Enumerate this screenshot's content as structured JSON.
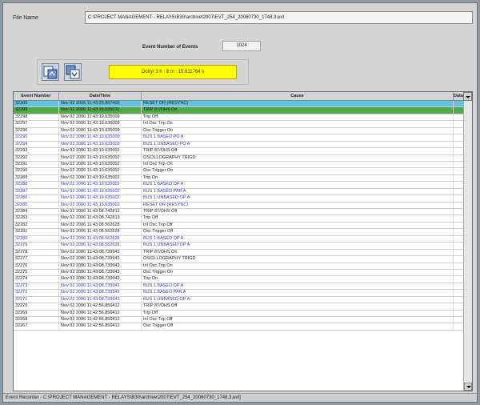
{
  "file": {
    "label": "File Name",
    "path": "C:\\PROJECT MANAGEMENT - RELAYS\\B30\\archive\\2007\\EVT_254_20060730_1748.3.evt"
  },
  "events": {
    "label": "Event Number of Events",
    "count": "1024"
  },
  "toolbar": {
    "status": "Oct/yr  3 h : 8 m : 15.611764 s"
  },
  "grid": {
    "columns": [
      "Event Number",
      "Date/Time",
      "Cause",
      "Data"
    ],
    "rows": [
      {
        "n": "32300",
        "t": "Nov 02 2006 11:43:25.867400",
        "c": "RESET OR (RESYNC)",
        "style": "sel-cyan"
      },
      {
        "n": "32299",
        "t": "Nov 02 2006 11:43:19.635011",
        "c": "TRIP 87/OHS  On",
        "style": "sel-green"
      },
      {
        "n": "32298",
        "t": "Nov 02 2006 11:43:19.635009",
        "c": "Trip       Off",
        "style": ""
      },
      {
        "n": "32297",
        "t": "Nov 02 2006 11:43:19.635009",
        "c": "Inl Osc Trip On",
        "style": ""
      },
      {
        "n": "32296",
        "t": "Nov 02 2006 11:43:19.635009",
        "c": "Osc Trigger On",
        "style": ""
      },
      {
        "n": "32295",
        "t": "Nov 02 2006 11:43:19.635009",
        "c": "BUS 1 BASED PO A",
        "style": "blue"
      },
      {
        "n": "32294",
        "t": "Nov 02 2006 11:43:19.635009",
        "c": "BUS 1 UNBASED PO A",
        "style": "blue"
      },
      {
        "n": "32293",
        "t": "Nov 02 2006 11:43:19.635002",
        "c": "TRIP 87/OHS  Off",
        "style": ""
      },
      {
        "n": "32292",
        "t": "Nov 02 2006 11:43:19.635002",
        "c": "OSCILLOGRAPHY TRIGD",
        "style": ""
      },
      {
        "n": "32291",
        "t": "Nov 02 2006 11:43:19.635002",
        "c": "Inl Osc Trip On",
        "style": ""
      },
      {
        "n": "32290",
        "t": "Nov 02 2006 11:43:19.635002",
        "c": "Osc Trigger On",
        "style": ""
      },
      {
        "n": "32289",
        "t": "Nov 02 2006 11:43:19.635002",
        "c": "Trip       On",
        "style": ""
      },
      {
        "n": "32288",
        "t": "Nov 02 2006 11:43:19.635002",
        "c": "BUS 1 BASED OP A",
        "style": "blue"
      },
      {
        "n": "32287",
        "t": "Nov 02 2006 11:43:19.635002",
        "c": "BUS 1 BASED PAR A",
        "style": "blue"
      },
      {
        "n": "32286",
        "t": "Nov 02 2006 11:43:19.635002",
        "c": "BUS 1 UNBASED OP A",
        "style": "blue"
      },
      {
        "n": "32285",
        "t": "Nov 02 2006 11:43:19.635002",
        "c": "RESET OR (RESYNC)",
        "style": "blue"
      },
      {
        "n": "32284",
        "t": "Nov 02 2006 11:43:08.742813",
        "c": "TRIP 87/OHS  Off",
        "style": ""
      },
      {
        "n": "32283",
        "t": "Nov 02 2006 11:43:08.742813",
        "c": "Trip       Off",
        "style": ""
      },
      {
        "n": "32282",
        "t": "Nov 02 2006 11:43:08.562628",
        "c": "Inl Osc Trip Off",
        "style": ""
      },
      {
        "n": "32281",
        "t": "Nov 02 2006 11:43:08.562628",
        "c": "Osc Trigger Off",
        "style": ""
      },
      {
        "n": "32280",
        "t": "Nov 02 2006 11:43:08.562628",
        "c": "BUS 1 BASED OP A",
        "style": "blue"
      },
      {
        "n": "32279",
        "t": "Nov 02 2006 11:43:08.562628",
        "c": "BUS 1 UNBASED OP A",
        "style": "blue"
      },
      {
        "n": "32278",
        "t": "Nov 02 2006 11:43:08.739943",
        "c": "TRIP 87/OHS  On",
        "style": ""
      },
      {
        "n": "32277",
        "t": "Nov 02 2006 11:43:08.739943",
        "c": "OSCILLOGRAPHY TRIGD",
        "style": ""
      },
      {
        "n": "32276",
        "t": "Nov 02 2006 11:43:08.739943",
        "c": "Inl Osc Trip On",
        "style": ""
      },
      {
        "n": "32275",
        "t": "Nov 02 2006 11:43:08.739943",
        "c": "Osc Trigger On",
        "style": ""
      },
      {
        "n": "32274",
        "t": "Nov 02 2006 11:43:08.739943",
        "c": "Trip       On",
        "style": ""
      },
      {
        "n": "32273",
        "t": "Nov 02 2006 11:43:08.739943",
        "c": "BUS 1 BASED OP A",
        "style": "blue"
      },
      {
        "n": "32272",
        "t": "Nov 02 2006 11:43:08.739943",
        "c": "BUS 1 BASED PAR A",
        "style": "blue"
      },
      {
        "n": "32271",
        "t": "Nov 02 2006 11:43:08.739943",
        "c": "BUS 1 UNBASED OP A",
        "style": "blue"
      },
      {
        "n": "32270",
        "t": "Nov 02 2006 11:42:56.856412",
        "c": "TRIP 87/OHS  Off",
        "style": ""
      },
      {
        "n": "32269",
        "t": "Nov 02 2006 11:42:56.856412",
        "c": "Trip       Off",
        "style": ""
      },
      {
        "n": "32268",
        "t": "Nov 02 2006 11:42:56.856412",
        "c": "Inl Osc Trip Off",
        "style": ""
      },
      {
        "n": "32267",
        "t": "Nov 02 2006 11:42:56.856412",
        "c": "Osc Trigger Off",
        "style": ""
      }
    ]
  },
  "statusbar": {
    "text": "Event Recorder - C:\\PROJECT MANAGEMENT - RELAYS\\B30\\archive\\2007\\EVT_254_20060730_1748.3.evt]"
  }
}
